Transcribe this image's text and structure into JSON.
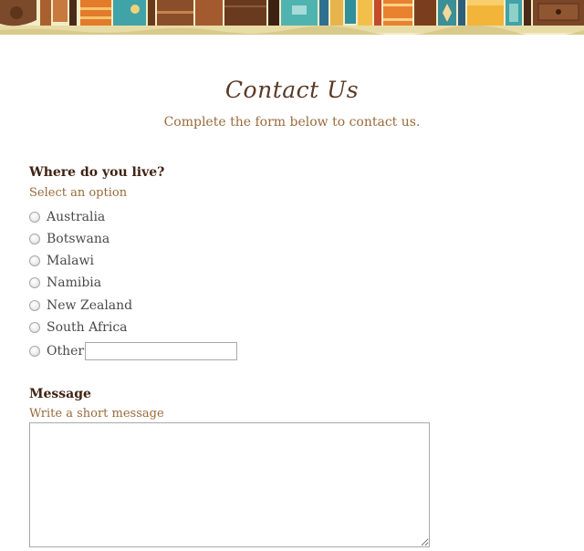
{
  "header": {
    "title": "Contact Us",
    "subtitle": "Complete the form below to contact us."
  },
  "location_question": {
    "label": "Where do you live?",
    "hint": "Select an option",
    "options": [
      {
        "label": "Australia"
      },
      {
        "label": "Botswana"
      },
      {
        "label": "Malawi"
      },
      {
        "label": "Namibia"
      },
      {
        "label": "New Zealand"
      },
      {
        "label": "South Africa"
      },
      {
        "label": "Other:"
      }
    ],
    "other_value": ""
  },
  "message_question": {
    "label": "Message",
    "hint": "Write a short message",
    "value": ""
  },
  "colors": {
    "heading": "#3f2213",
    "hint": "#9a6a3a",
    "title": "#5a3a26"
  }
}
